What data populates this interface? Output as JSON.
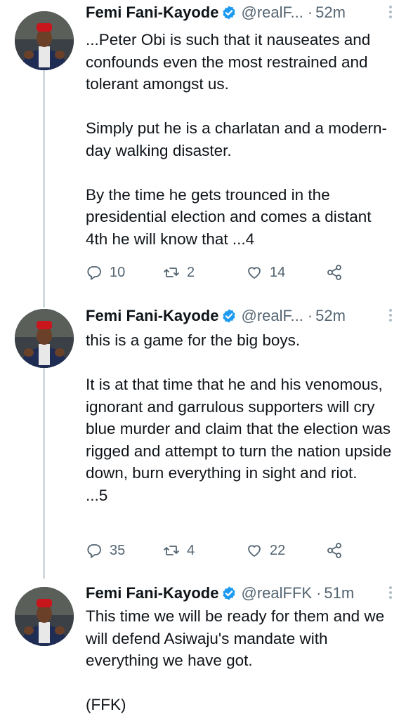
{
  "tweets": [
    {
      "name": "Femi Fani-Kayode",
      "handle": "@realF...",
      "dot": "·",
      "time": "52m",
      "paragraphs": [
        "...Peter Obi is such that it nauseates and confounds even the most restrained and tolerant amongst us.",
        "Simply put he is a charlatan and a modern-day walking disaster.",
        "By the time he gets trounced in the presidential election and comes a distant 4th he will know that ...4"
      ],
      "replies": "10",
      "retweets": "2",
      "likes": "14"
    },
    {
      "name": "Femi Fani-Kayode",
      "handle": "@realF...",
      "dot": "·",
      "time": "52m",
      "paragraphs": [
        "this is a game for the big boys.",
        "It is at that time that he and his venomous, ignorant and garrulous supporters will cry blue murder and claim that the election was rigged and attempt to turn the nation upside down, burn everything in sight and riot.\n...5"
      ],
      "replies": "35",
      "retweets": "4",
      "likes": "22"
    },
    {
      "name": "Femi Fani-Kayode",
      "handle": "@realFFK",
      "dot": "·",
      "time": "51m",
      "paragraphs": [
        "This time we will be ready for them and we will defend Asiwaju's mandate with everything we have got.",
        "(FFK)"
      ]
    }
  ],
  "icons": {
    "verified": "verified-badge-icon",
    "reply": "reply-icon",
    "retweet": "retweet-icon",
    "like": "heart-icon",
    "share": "share-icon",
    "more": "more-vertical-icon"
  },
  "colors": {
    "text": "#0f1419",
    "secondary": "#536471",
    "verified": "#1d9bf0",
    "thread_line": "#cfd9de"
  }
}
